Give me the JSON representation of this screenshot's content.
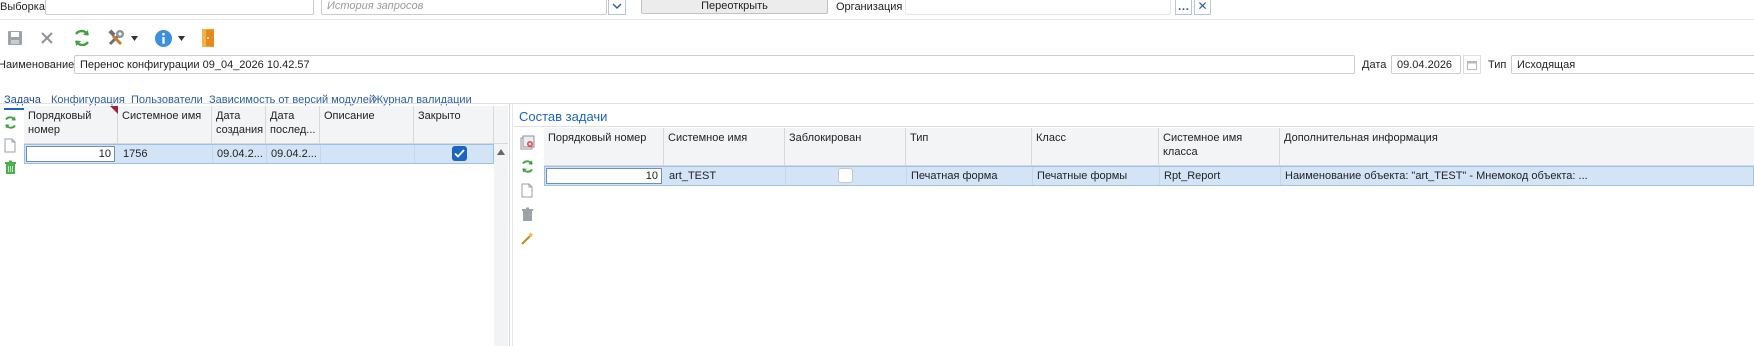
{
  "filterbar": {
    "sample_label": "Выборка",
    "sample_value": "",
    "history_placeholder": "История запросов",
    "reopen_label": "Переоткрыть",
    "org_label": "Организация",
    "org_value": "",
    "more_label": "…",
    "clear_label": "✕"
  },
  "toolbar": {
    "icons": [
      "save-icon",
      "close-icon",
      "refresh-icon",
      "tools-icon",
      "info-icon",
      "exit-icon"
    ]
  },
  "header": {
    "name_label": "Наименование",
    "name_value": "Перенос конфигурации 09_04_2026 10.42.57",
    "date_label": "Дата",
    "date_value": "09.04.2026",
    "type_label": "Тип",
    "type_value": "Исходящая"
  },
  "tabs": [
    {
      "label": "Задача",
      "active": true
    },
    {
      "label": "Конфигурация",
      "active": false
    },
    {
      "label": "Пользователи",
      "active": false
    },
    {
      "label": "Зависимость от версий модулей",
      "active": false
    },
    {
      "label": "Журнал валидации",
      "active": false
    }
  ],
  "left_grid": {
    "columns": [
      "Порядковый номер",
      "Системное имя",
      "Дата создания",
      "Дата послед...",
      "Описание",
      "Закрыто"
    ],
    "rows": [
      {
        "order": "10",
        "sysname": "1756",
        "created": "09.04.2...",
        "modified": "09.04.2...",
        "description": "",
        "closed": true
      }
    ]
  },
  "right_panel": {
    "title": "Состав задачи",
    "columns": [
      "Порядковый номер",
      "Системное имя",
      "Заблокирован",
      "Тип",
      "Класс",
      "Системное имя класса",
      "Дополнительная информация"
    ],
    "rows": [
      {
        "order": "10",
        "sysname": "art_TEST",
        "blocked": false,
        "type": "Печатная форма",
        "class": "Печатные формы",
        "class_sysname": "Rpt_Report",
        "info": "Наименование объекта: \"art_TEST\" - Мнемокод объекта: ..."
      }
    ]
  },
  "colors": {
    "accent": "#1c64c4",
    "selection": "#d4e4f7",
    "green": "#3ea33e"
  }
}
